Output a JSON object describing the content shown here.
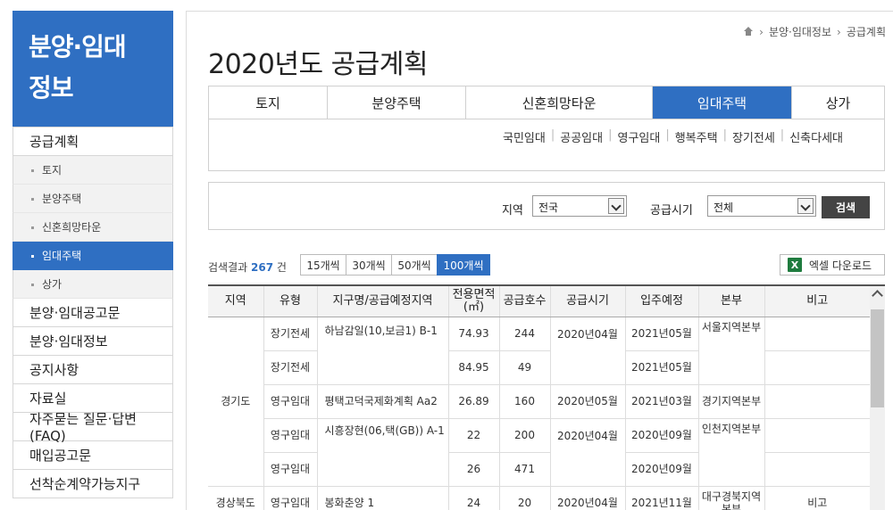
{
  "sidebar": {
    "title_line1": "분양·임대",
    "title_line2": "정보",
    "menu": [
      {
        "label": "공급계획"
      },
      {
        "label": "토지"
      },
      {
        "label": "분양주택"
      },
      {
        "label": "신혼희망타운"
      },
      {
        "label": "임대주택"
      },
      {
        "label": "상가"
      },
      {
        "label": "분양·임대공고문"
      },
      {
        "label": "분양·임대정보"
      },
      {
        "label": "공지사항"
      },
      {
        "label": "자료실"
      },
      {
        "label": "자주묻는 질문·답변(FAQ)"
      },
      {
        "label": "매입공고문"
      },
      {
        "label": "선착순계약가능지구"
      }
    ]
  },
  "breadcrumb": {
    "items": [
      "분양·임대정보",
      "공급계획"
    ]
  },
  "page_title": "2020년도 공급계획",
  "tabs": [
    "토지",
    "분양주택",
    "신혼희망타운",
    "임대주택",
    "상가"
  ],
  "subtabs": [
    "국민임대",
    "공공임대",
    "영구임대",
    "행복주택",
    "장기전세",
    "신축다세대"
  ],
  "filter": {
    "region_label": "지역",
    "region_value": "전국",
    "period_label": "공급시기",
    "period_value": "전체",
    "search_label": "검색"
  },
  "result": {
    "prefix": "검색결과",
    "count": "267",
    "suffix": "건"
  },
  "page_sizes": [
    "15개씩",
    "30개씩",
    "50개씩",
    "100개씩"
  ],
  "excel_label": "엑셀 다운로드",
  "excel_icon": "X",
  "table": {
    "headers": [
      "지역",
      "유형",
      "지구명/공급예정지역",
      "전용면적(㎡)",
      "공급호수",
      "공급시기",
      "입주예정",
      "본부",
      "비고"
    ],
    "rows": [
      [
        "경기도",
        "장기전세",
        "하남감일(10,보금1) B-1",
        "74.93",
        "244",
        "2020년04월",
        "2021년05월",
        "서울지역본부",
        ""
      ],
      [
        "",
        "장기전세",
        "",
        "84.95",
        "49",
        "",
        "2021년05월",
        "",
        ""
      ],
      [
        "",
        "영구임대",
        "평택고덕국제화계획 Aa2",
        "26.89",
        "160",
        "2020년05월",
        "2021년03월",
        "경기지역본부",
        ""
      ],
      [
        "",
        "영구임대",
        "시흥장현(06,택(GB)) A-1",
        "22",
        "200",
        "2020년04월",
        "2020년09월",
        "인천지역본부",
        ""
      ],
      [
        "",
        "영구임대",
        "",
        "26",
        "471",
        "",
        "2020년09월",
        "",
        ""
      ],
      [
        "경상북도",
        "영구임대",
        "봉화춘양 1",
        "24",
        "20",
        "2020년04월",
        "2021년11월",
        "대구경북지역본부",
        "비고"
      ]
    ]
  }
}
